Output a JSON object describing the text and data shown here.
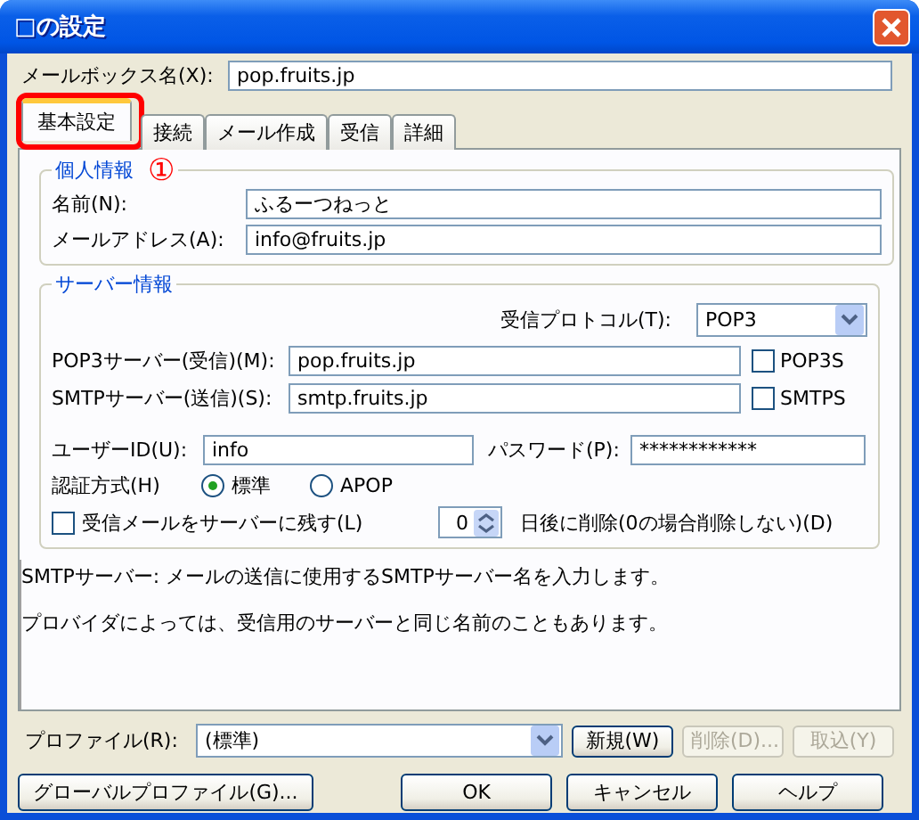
{
  "window": {
    "title": "□の設定"
  },
  "mailbox": {
    "label": "メールボックス名(X):",
    "value": "pop.fruits.jp"
  },
  "tabs": [
    {
      "label": "基本設定",
      "selected": true,
      "highlighted": true
    },
    {
      "label": "接続",
      "selected": false,
      "highlighted": false
    },
    {
      "label": "メール作成",
      "selected": false,
      "highlighted": false
    },
    {
      "label": "受信",
      "selected": false,
      "highlighted": false
    },
    {
      "label": "詳細",
      "selected": false,
      "highlighted": false
    }
  ],
  "personal": {
    "title": "個人情報",
    "annotation": "①",
    "fields": [
      {
        "label": "名前(N):",
        "value": "ふるーつねっと"
      },
      {
        "label": "メールアドレス(A):",
        "value": "info@fruits.jp"
      }
    ]
  },
  "server": {
    "title": "サーバー情報",
    "protocol": {
      "label": "受信プロトコル(T):",
      "value": "POP3"
    },
    "servers": [
      {
        "label": "POP3サーバー(受信)(M):",
        "value": "pop.fruits.jp",
        "option": "POP3S",
        "checked": false
      },
      {
        "label": "SMTPサーバー(送信)(S):",
        "value": "smtp.fruits.jp",
        "option": "SMTPS",
        "checked": false
      }
    ],
    "user": {
      "label": "ユーザーID(U):",
      "value": "info"
    },
    "password": {
      "label": "パスワード(P):",
      "value": "************"
    },
    "auth": {
      "label": "認証方式(H)",
      "options": [
        {
          "label": "標準",
          "selected": true
        },
        {
          "label": "APOP",
          "selected": false
        }
      ]
    },
    "leave": {
      "label": "受信メールをサーバーに残す(L)",
      "checked": false,
      "days": "0",
      "after": "日後に削除(0の場合削除しない)(D)"
    }
  },
  "help_text": [
    "SMTPサーバー: メールの送信に使用するSMTPサーバー名を入力します。",
    "プロバイダによっては、受信用のサーバーと同じ名前のこともあります。"
  ],
  "profile": {
    "label": "プロファイル(R):",
    "value": "(標準)",
    "buttons": [
      {
        "label": "新規(W)",
        "disabled": false
      },
      {
        "label": "削除(D)...",
        "disabled": true
      },
      {
        "label": "取込(Y)",
        "disabled": true
      }
    ]
  },
  "buttons": [
    {
      "label": "グローバルプロファイル(G)..."
    },
    {
      "label": "OK"
    },
    {
      "label": "キャンセル"
    },
    {
      "label": "ヘルプ"
    }
  ]
}
